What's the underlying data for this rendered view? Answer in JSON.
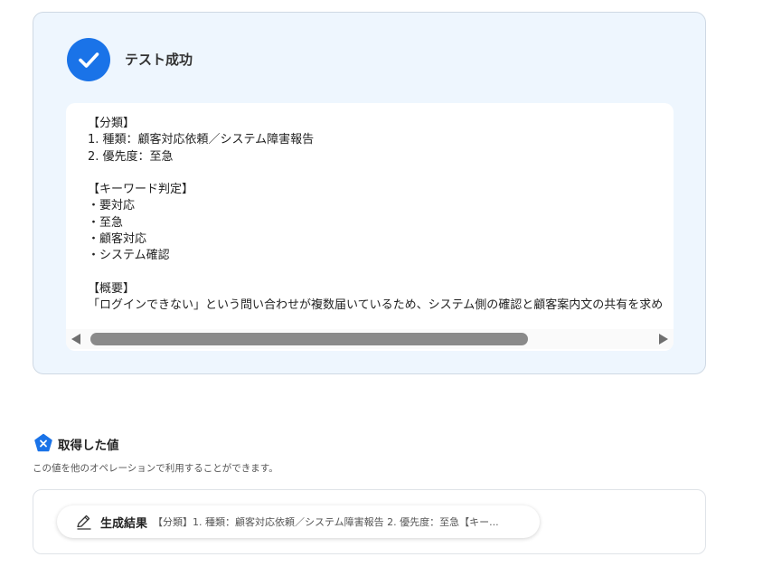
{
  "test_result": {
    "title": "テスト成功",
    "output_text": "【分類】\n1. 種類：顧客対応依頼／システム障害報告\n2. 優先度：至急\n\n【キーワード判定】\n・要対応\n・至急\n・顧客対応\n・システム確認\n\n【概要】\n「ログインできない」という問い合わせが複数届いているため、システム側の確認と顧客案内文の共有を求め"
  },
  "acquired_values": {
    "title": "取得した値",
    "description": "この値を他のオペレーションで利用することができます。",
    "items": [
      {
        "label": "生成結果",
        "value": "【分類】1. 種類：顧客対応依頼／システム障害報告 2. 優先度：至急【キー..."
      }
    ]
  },
  "colors": {
    "accent": "#1a73e8",
    "card_background": "#eef6fe"
  },
  "icons": {
    "success": "check-circle-icon",
    "values": "variable-badge-icon",
    "generated": "pen-sparkle-icon"
  }
}
